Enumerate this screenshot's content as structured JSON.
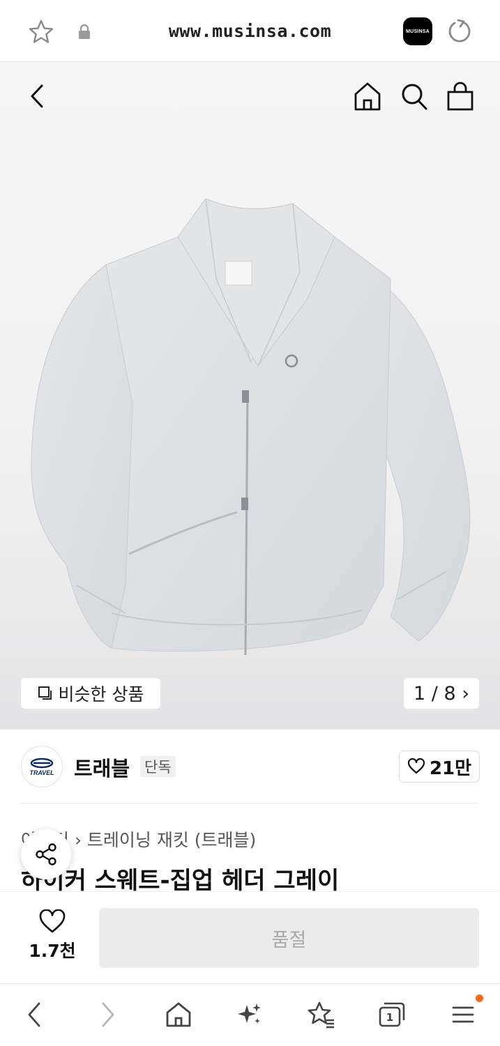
{
  "browser": {
    "url": "www.musinsa.com",
    "site_logo_text": "MUSINSA",
    "icons": [
      "star-icon",
      "lock-icon",
      "reload-icon"
    ]
  },
  "header": {
    "icons": [
      "back-icon",
      "home-icon",
      "search-icon",
      "shopping-bag-icon"
    ]
  },
  "gallery": {
    "similar_label": "비슷한 상품",
    "page_counter": "1 / 8 ›",
    "image_subject": "gray zip-up sweatshirt"
  },
  "brand": {
    "logo_text": "TRAVEL",
    "name": "트래블",
    "badge": "단독",
    "likes": "21만"
  },
  "product": {
    "breadcrumb": "아우터 › 트레이닝 재킷 (트래블)",
    "title": "하이커 스웨트-집업 헤더 그레이"
  },
  "purchase": {
    "wish_count": "1.7천",
    "soldout_label": "품절"
  },
  "bottom_nav": {
    "icons": [
      "back-icon",
      "forward-icon",
      "home-icon",
      "sparkle-icon",
      "bookmarks-icon",
      "tabs-icon",
      "menu-icon"
    ],
    "tabs_count": "1"
  },
  "colors": {
    "accent": "#ff6a1a",
    "brand_logo_blue": "#0d2a6b",
    "soldout_bg": "#ececec"
  }
}
